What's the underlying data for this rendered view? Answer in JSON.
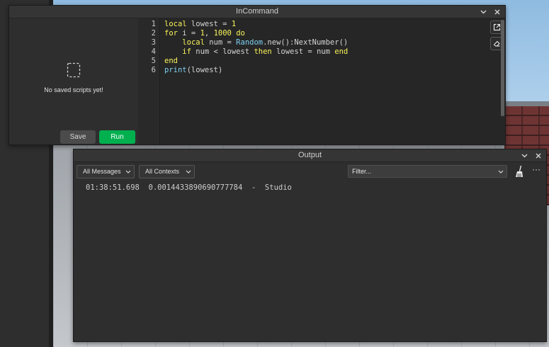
{
  "incommand": {
    "title": "InCommand",
    "sidebar": {
      "empty_message": "No saved scripts yet!",
      "save_label": "Save",
      "run_label": "Run"
    },
    "editor": {
      "line_numbers": [
        "1",
        "2",
        "3",
        "4",
        "5",
        "6"
      ],
      "code_lines": [
        "local lowest = 1",
        "for i = 1, 1000 do",
        "    local num = Random.new():NextNumber()",
        "    if num < lowest then lowest = num end",
        "end",
        "print(lowest)"
      ],
      "popout_icon": "open-external-icon",
      "clear_icon": "eraser-icon"
    }
  },
  "output": {
    "title": "Output",
    "messages_filter": "All Messages",
    "contexts_filter": "All Contexts",
    "filter_placeholder": "Filter...",
    "log": [
      {
        "time": "01:38:51.698",
        "message": "0.0014433890690777784",
        "separator": "-",
        "source": "Studio"
      }
    ]
  },
  "colors": {
    "run_button": "#00b04f",
    "keyword": "#f8f35a",
    "builtin": "#7ed0f0",
    "window_bg": "#2e2e2e",
    "editor_bg": "#262626"
  }
}
